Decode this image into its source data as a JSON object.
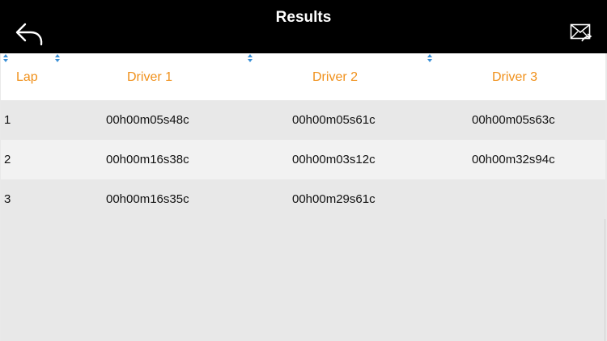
{
  "navbar": {
    "title": "Results",
    "back_icon": "back-arrow-icon",
    "share_icon": "mail-share-icon",
    "background": "#000000",
    "title_color": "#ffffff"
  },
  "table": {
    "accent_color": "#f0901a",
    "columns": [
      "Lap",
      "Driver 1",
      "Driver 2",
      "Driver 3"
    ],
    "rows": [
      {
        "lap": "1",
        "driver1": "00h00m05s48c",
        "driver2": "00h00m05s61c",
        "driver3": "00h00m05s63c"
      },
      {
        "lap": "2",
        "driver1": "00h00m16s38c",
        "driver2": "00h00m03s12c",
        "driver3": "00h00m32s94c"
      },
      {
        "lap": "3",
        "driver1": "00h00m16s35c",
        "driver2": "00h00m29s61c",
        "driver3": ""
      }
    ]
  }
}
